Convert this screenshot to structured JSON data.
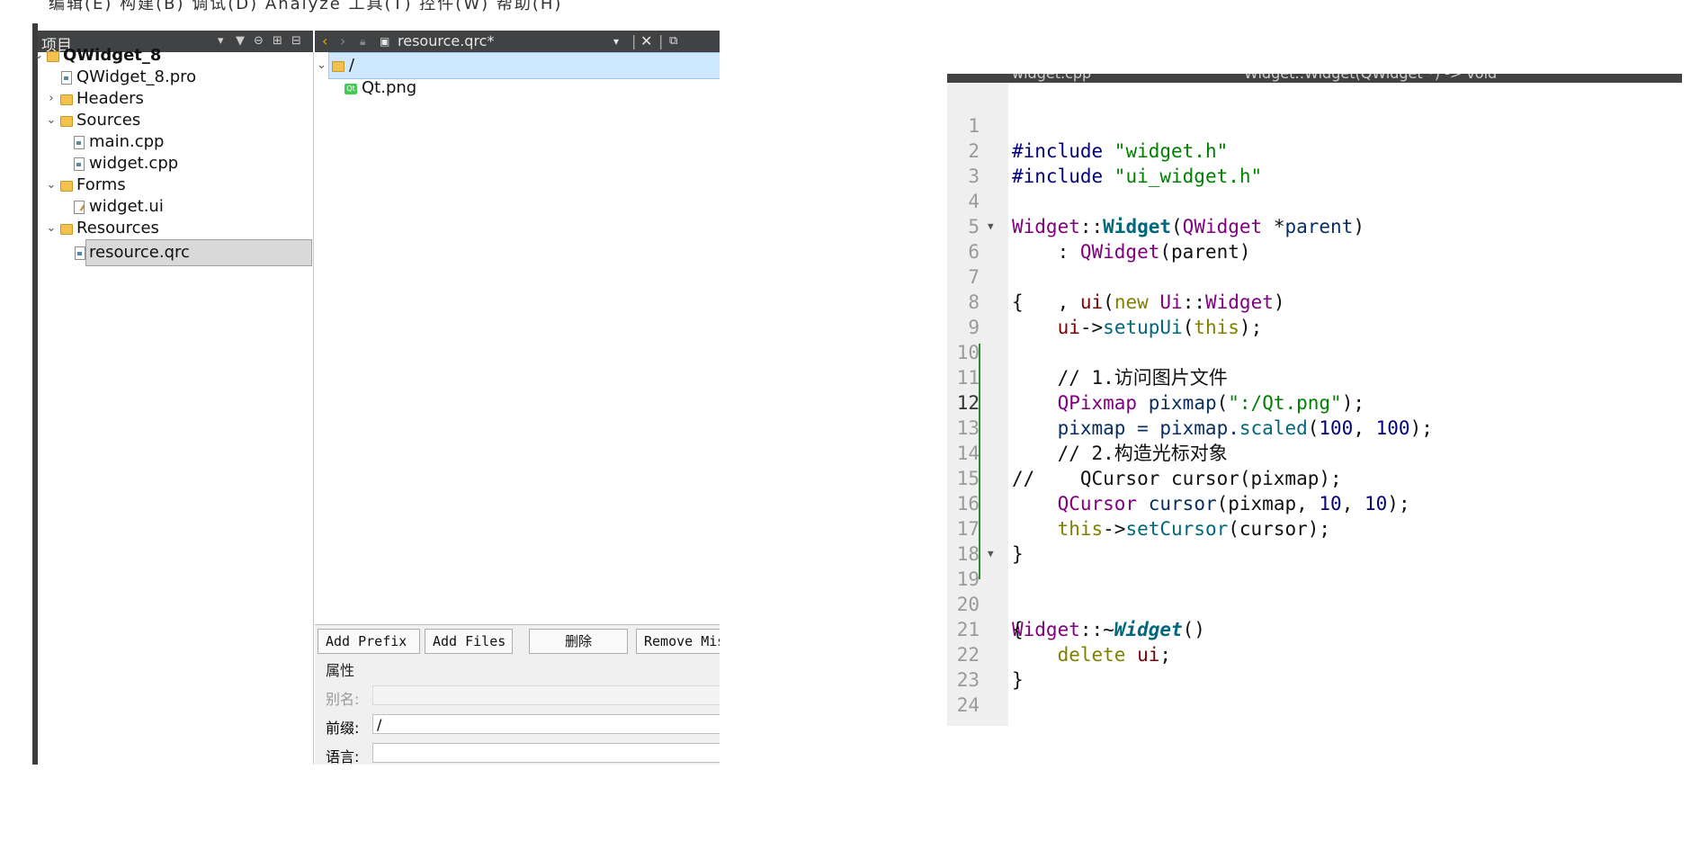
{
  "left": {
    "top_menu_fragment": "编辑(E)  构建(B)  调试(D)  Analyze  工具(T)  控件(W)  帮助(H)",
    "project_header": {
      "title": "项目"
    },
    "tree": [
      {
        "label": "QWidget_8",
        "bold": true
      },
      {
        "label": "QWidget_8.pro"
      },
      {
        "label": "Headers"
      },
      {
        "label": "Sources"
      },
      {
        "label": "main.cpp"
      },
      {
        "label": "widget.cpp"
      },
      {
        "label": "Forms"
      },
      {
        "label": "widget.ui"
      },
      {
        "label": "Resources"
      },
      {
        "label": "resource.qrc",
        "selected": true
      }
    ],
    "editor_toolbar": {
      "file": "resource.qrc*"
    },
    "qrc_tree": [
      {
        "label": "/"
      },
      {
        "label": "Qt.png"
      }
    ],
    "buttons": {
      "add_prefix": "Add Prefix",
      "add_files": "Add Files",
      "delete": "删除",
      "remove_missing": "Remove Mis"
    },
    "properties": {
      "group_title": "属性",
      "alias_label": "别名:",
      "alias_value": "",
      "prefix_label": "前缀:",
      "prefix_value": "/",
      "language_label": "语言:",
      "language_value": ""
    },
    "colors": {
      "header_bg": "#404244",
      "selection_bg": "#d9d9d9",
      "qrc_selection_bg": "#cde8ff"
    }
  },
  "right": {
    "tab_fragment": {
      "file": "widget.cpp",
      "function": "Widget::Widget(QWidget *) -> void"
    },
    "current_line": "12",
    "lines": [
      {
        "n": "1"
      },
      {
        "n": "2"
      },
      {
        "n": "3"
      },
      {
        "n": "4"
      },
      {
        "n": "5"
      },
      {
        "n": "6"
      },
      {
        "n": "7"
      },
      {
        "n": "8"
      },
      {
        "n": "9"
      },
      {
        "n": "10"
      },
      {
        "n": "11"
      },
      {
        "n": "12"
      },
      {
        "n": "13"
      },
      {
        "n": "14"
      },
      {
        "n": "15"
      },
      {
        "n": "16"
      },
      {
        "n": "17"
      },
      {
        "n": "18"
      },
      {
        "n": "19"
      },
      {
        "n": "20"
      },
      {
        "n": "21"
      },
      {
        "n": "22"
      },
      {
        "n": "23"
      },
      {
        "n": "24"
      }
    ],
    "code": {
      "l1": {
        "a": "#include ",
        "b": "\"widget.h\""
      },
      "l2": {
        "a": "#include ",
        "b": "\"ui_widget.h\""
      },
      "l4": {
        "a": "Widget",
        "b": "::",
        "c": "Widget",
        "d": "(",
        "e": "QWidget",
        "f": " *",
        "g": "parent",
        "h": ")"
      },
      "l5": {
        "a": "    : ",
        "b": "QWidget",
        "c": "(parent)"
      },
      "l6": {
        "a": "    , ",
        "b": "ui",
        "c": "(",
        "d": "new",
        "e": " ",
        "f": "Ui",
        "g": "::",
        "h": "Widget",
        "i": ")"
      },
      "l7": "{",
      "l8": {
        "a": "    ",
        "b": "ui",
        "c": "->",
        "d": "setupUi",
        "e": "(",
        "f": "this",
        "g": ");"
      },
      "l10": "    // 1.访问图片文件",
      "l11": {
        "a": "    ",
        "b": "QPixmap",
        "c": " ",
        "d": "pixmap",
        "e": "(",
        "f": "\":/Qt.png\"",
        "g": ");"
      },
      "l12": {
        "a": "    pixmap = pixmap.",
        "b": "scaled",
        "c": "(",
        "d": "100",
        "e": ", ",
        "f": "100",
        "g": ");"
      },
      "l13": "    // 2.构造光标对象",
      "l14": "//    QCursor cursor(pixmap);",
      "l15": {
        "a": "    ",
        "b": "QCursor",
        "c": " ",
        "d": "cursor",
        "e": "(pixmap, ",
        "f": "10",
        "g": ", ",
        "h": "10",
        "i": ");"
      },
      "l16": {
        "a": "    ",
        "b": "this",
        "c": "->",
        "d": "setCursor",
        "e": "(cursor);"
      },
      "l17": "}",
      "l19": {
        "a": "Widget",
        "b": "::~",
        "c": "Widget",
        "d": "()"
      },
      "l20": "{",
      "l21": {
        "a": "    ",
        "b": "delete",
        "c": " ",
        "d": "ui",
        "e": ";"
      },
      "l22": "}"
    },
    "colors": {
      "keyword": "#808000",
      "string": "#008000",
      "type": "#800080",
      "function": "#00677c",
      "number": "#000080",
      "comment": "#008000",
      "gutter": "#efefef"
    }
  }
}
